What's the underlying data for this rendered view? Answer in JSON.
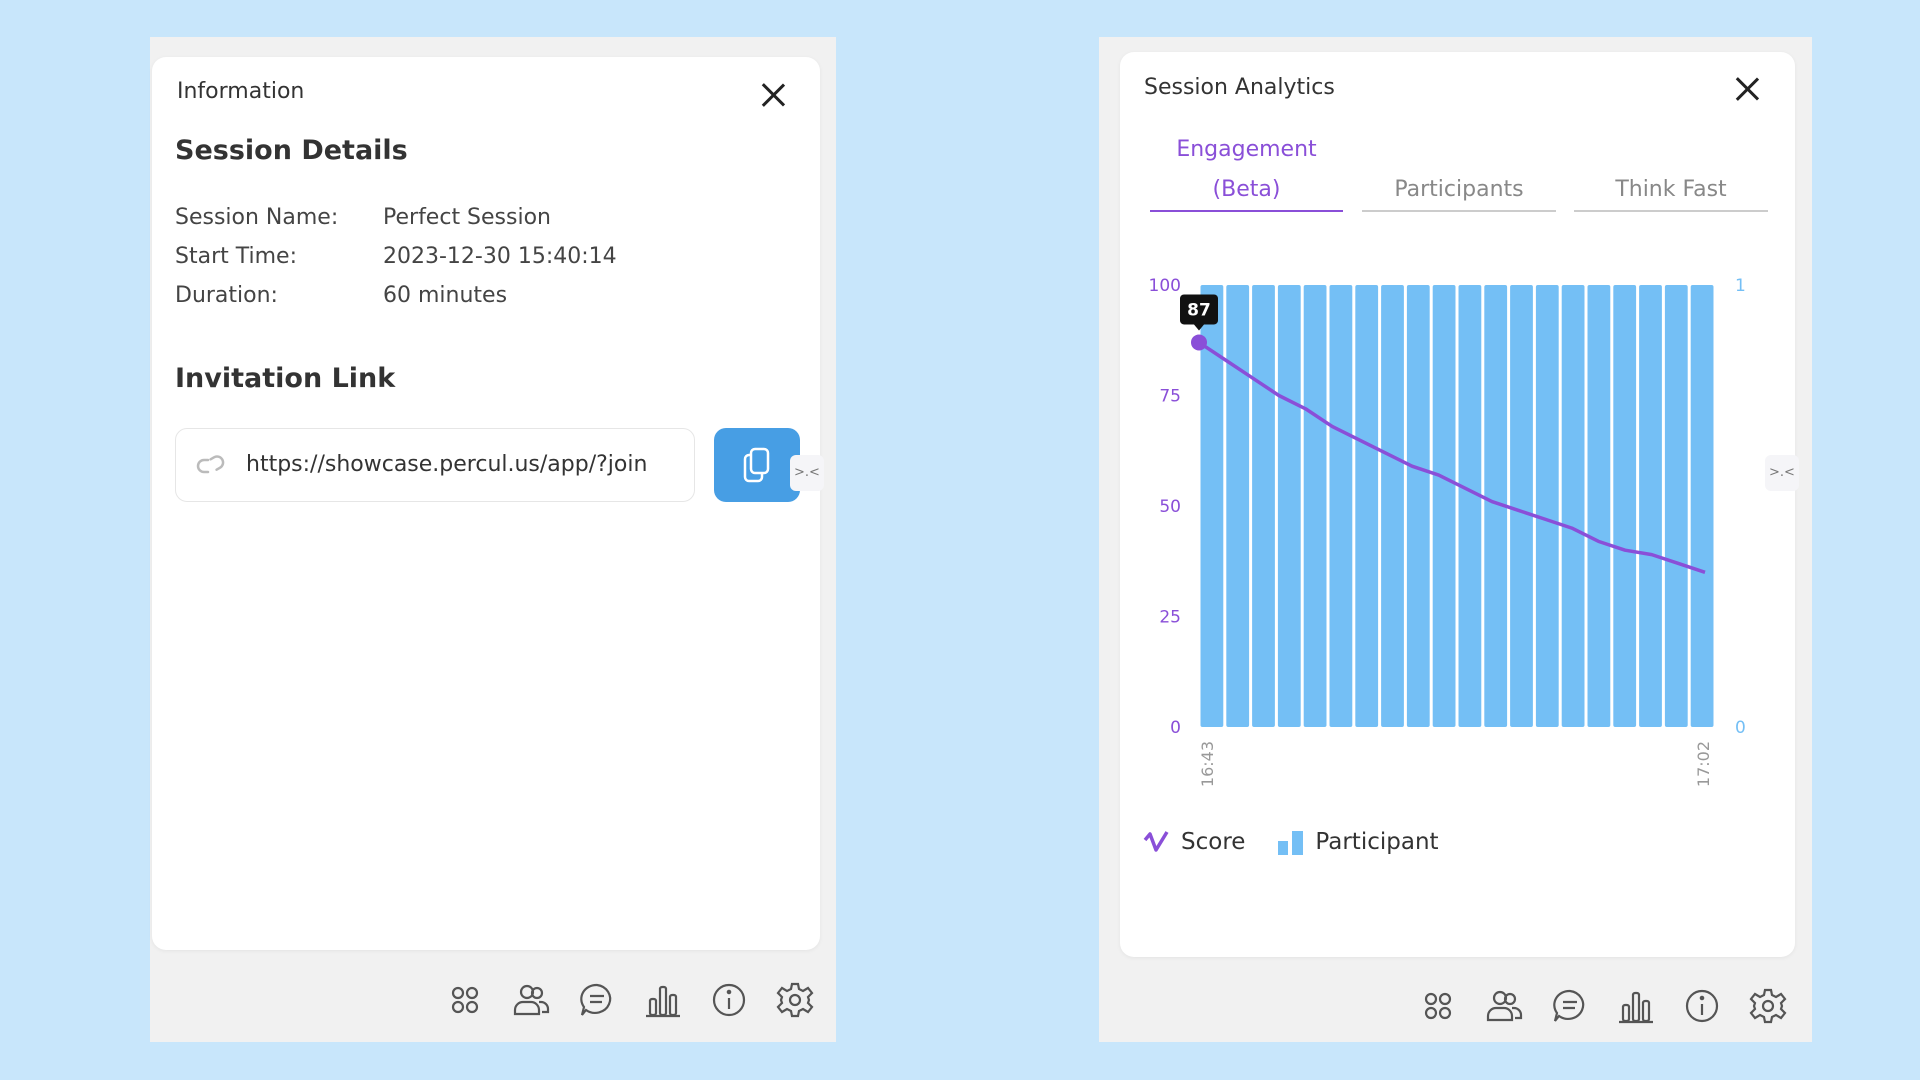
{
  "info_panel": {
    "title": "Information",
    "session_details_heading": "Session Details",
    "details": [
      {
        "label": "Session Name:",
        "value": "Perfect Session"
      },
      {
        "label": "Start Time:",
        "value": "2023-12-30 15:40:14"
      },
      {
        "label": "Duration:",
        "value": "60 minutes"
      }
    ],
    "invitation_heading": "Invitation Link",
    "invitation_url": "https://showcase.percul.us/app/?join"
  },
  "analytics_panel": {
    "title": "Session Analytics",
    "tabs": [
      {
        "label_line1": "Engagement",
        "label_line2": "(Beta)",
        "active": true
      },
      {
        "label": "Participants",
        "active": false
      },
      {
        "label": "Think Fast",
        "active": false
      }
    ],
    "legend": {
      "score": "Score",
      "participant": "Participant"
    },
    "tooltip": "87"
  },
  "toolbar_icons": [
    "grid-icon",
    "participants-icon",
    "chat-icon",
    "bar-chart-icon",
    "info-icon",
    "gear-icon"
  ],
  "colors": {
    "accent_purple": "#8a4fd8",
    "bar_blue": "#74bff5",
    "copy_button": "#479ee4",
    "background": "#c8e6fb"
  },
  "chart_data": {
    "type": "bar+line",
    "x_tick_labels": [
      "16:43",
      "17:02"
    ],
    "left_axis": {
      "ticks": [
        0,
        25,
        50,
        75,
        100
      ],
      "range": [
        0,
        100
      ],
      "color": "#8a4fd8"
    },
    "right_axis": {
      "ticks": [
        0,
        1
      ],
      "range": [
        0,
        1
      ],
      "color": "#74bff5"
    },
    "series": [
      {
        "name": "Participant",
        "type": "bar",
        "axis": "right",
        "values": [
          1,
          1,
          1,
          1,
          1,
          1,
          1,
          1,
          1,
          1,
          1,
          1,
          1,
          1,
          1,
          1,
          1,
          1,
          1,
          1
        ]
      },
      {
        "name": "Score",
        "type": "line",
        "axis": "left",
        "values": [
          87,
          83,
          79,
          75,
          72,
          68,
          65,
          62,
          59,
          57,
          54,
          51,
          49,
          47,
          45,
          42,
          40,
          39,
          37,
          35
        ]
      }
    ],
    "grid": false,
    "legend_placement": "bottom-left"
  }
}
